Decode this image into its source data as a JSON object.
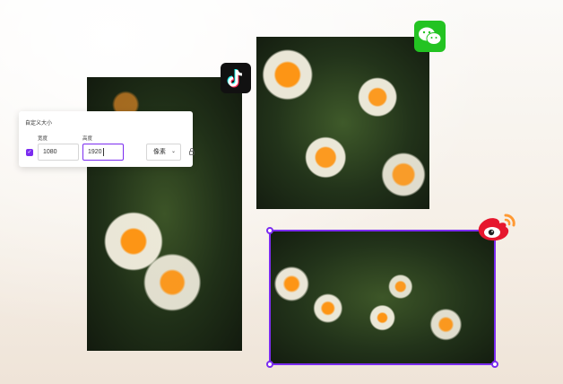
{
  "panel": {
    "title": "自定义大小",
    "width_label": "宽度",
    "height_label": "高度",
    "width_value": "1080",
    "height_value": "1920",
    "unit": "像素",
    "aspect_checked": true
  },
  "icons": {
    "tiktok": "tiktok-logo",
    "wechat": "wechat-logo",
    "weibo": "weibo-logo",
    "lock": "lock-icon"
  },
  "colors": {
    "accent": "#7b2cf0",
    "wechat_green": "#23c322",
    "weibo_red": "#e6162d"
  }
}
